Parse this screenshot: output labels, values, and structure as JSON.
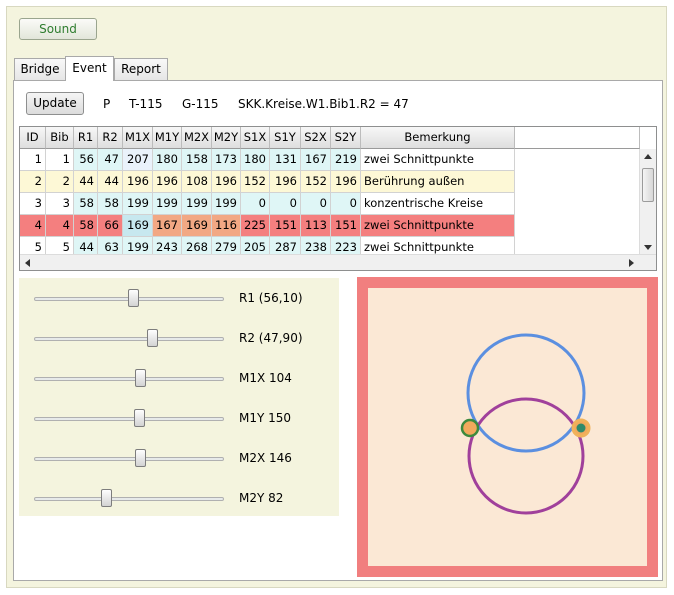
{
  "toolbar": {
    "sound_label": "Sound"
  },
  "tabs": [
    {
      "label": "Bridge",
      "active": false
    },
    {
      "label": "Event",
      "active": true
    },
    {
      "label": "Report",
      "active": false
    }
  ],
  "info": {
    "update_label": "Update",
    "p": "P",
    "t": "T-115",
    "g": "G-115",
    "expression": "SKK.Kreise.W1.Bib1.R2 = 47"
  },
  "table": {
    "headers": [
      "ID",
      "Bib",
      "R1",
      "R2",
      "M1X",
      "M1Y",
      "M2X",
      "M2Y",
      "S1X",
      "S1Y",
      "S2X",
      "S2Y",
      "Bemerkung"
    ],
    "rows": [
      [
        "1",
        "1",
        "56",
        "47",
        "207",
        "180",
        "158",
        "173",
        "180",
        "131",
        "167",
        "219",
        "zwei Schnittpunkte"
      ],
      [
        "2",
        "2",
        "44",
        "44",
        "196",
        "196",
        "108",
        "196",
        "152",
        "196",
        "152",
        "196",
        "Berührung außen"
      ],
      [
        "3",
        "3",
        "58",
        "58",
        "199",
        "199",
        "199",
        "199",
        "0",
        "0",
        "0",
        "0",
        "konzentrische Kreise"
      ],
      [
        "4",
        "4",
        "58",
        "66",
        "169",
        "167",
        "169",
        "116",
        "225",
        "151",
        "113",
        "151",
        "zwei Schnittpunkte"
      ],
      [
        "5",
        "5",
        "44",
        "63",
        "199",
        "243",
        "268",
        "279",
        "205",
        "287",
        "238",
        "223",
        "zwei Schnittpunkte"
      ]
    ],
    "selected_row": 3
  },
  "sliders": [
    {
      "label": "R1 (56,10)",
      "value": 0.52
    },
    {
      "label": "R2 (47,90)",
      "value": 0.62
    },
    {
      "label": "M1X 104",
      "value": 0.56
    },
    {
      "label": "M1Y 150",
      "value": 0.55
    },
    {
      "label": "M2X 146",
      "value": 0.56
    },
    {
      "label": "M2Y 82",
      "value": 0.38
    }
  ],
  "colors": {
    "circle1": "#5b8fe0",
    "circle2": "#a0409b",
    "canvas_border": "#f17f7f",
    "canvas_bg": "#fbe8d5",
    "row_selected": "#f47f7f",
    "row_hover": "#fdf8d6",
    "header_cyan": "#dff6f6"
  }
}
